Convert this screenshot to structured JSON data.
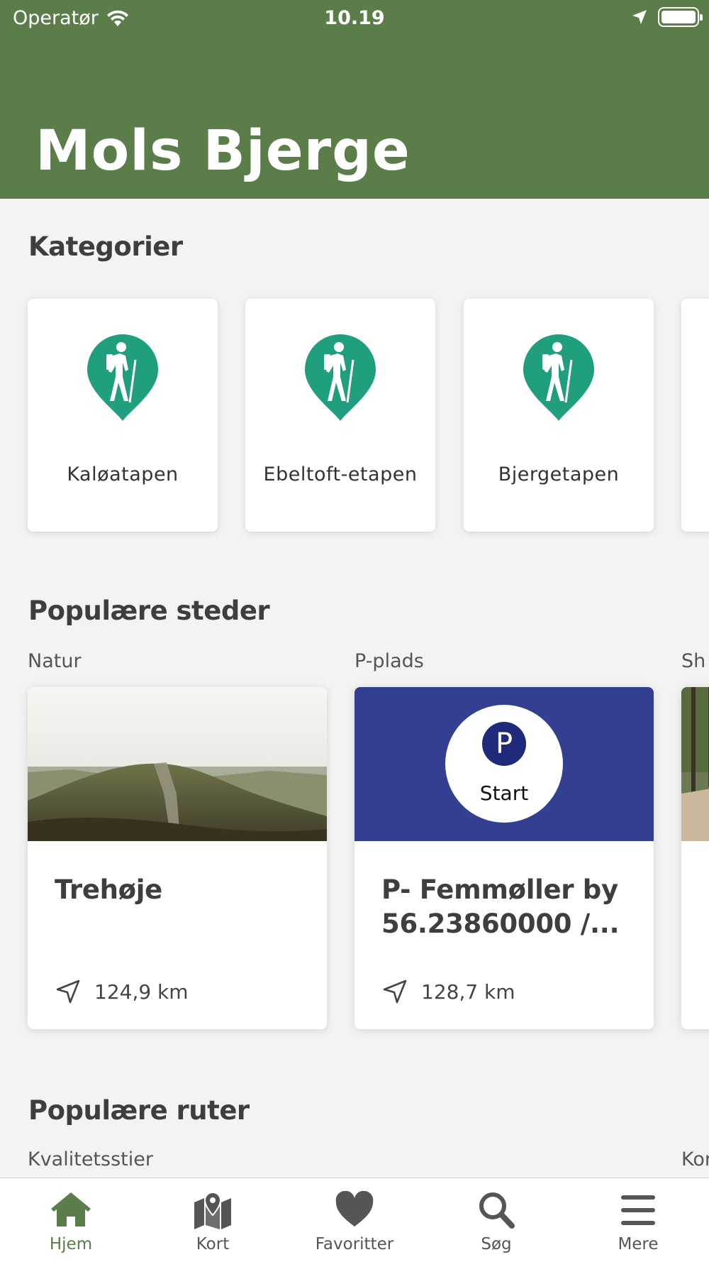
{
  "status_bar": {
    "carrier": "Operatør",
    "time": "10.19"
  },
  "header": {
    "title": "Mols Bjerge"
  },
  "categories": {
    "title": "Kategorier",
    "items": [
      {
        "label": "Kaløatapen",
        "icon": "hiker-pin-icon"
      },
      {
        "label": "Ebeltoft-etapen",
        "icon": "hiker-pin-icon"
      },
      {
        "label": "Bjergetapen",
        "icon": "hiker-pin-icon"
      }
    ]
  },
  "popular_places": {
    "title": "Populære steder",
    "groups": [
      {
        "label": "Natur",
        "card": {
          "title": "Trehøje",
          "distance": "124,9 km"
        }
      },
      {
        "label": "P-plads",
        "card": {
          "title": "P- Femmøller by 56.23860000 /...",
          "distance": "128,7 km",
          "badge_letter": "P",
          "badge_text": "Start"
        }
      },
      {
        "label": "Sh"
      }
    ]
  },
  "popular_routes": {
    "title": "Populære ruter",
    "groups": [
      {
        "label": "Kvalitetsstier"
      },
      {
        "label": "Kor"
      }
    ]
  },
  "tabbar": {
    "items": [
      {
        "label": "Hjem",
        "icon": "home-icon",
        "active": true
      },
      {
        "label": "Kort",
        "icon": "map-pin-icon"
      },
      {
        "label": "Favoritter",
        "icon": "heart-icon"
      },
      {
        "label": "Søg",
        "icon": "search-icon"
      },
      {
        "label": "Mere",
        "icon": "menu-icon"
      }
    ]
  },
  "colors": {
    "header_green": "#5b7d4a",
    "pin_teal": "#1f9f7e",
    "parking_blue": "#333f91",
    "parking_badge": "#1f2a7a"
  }
}
